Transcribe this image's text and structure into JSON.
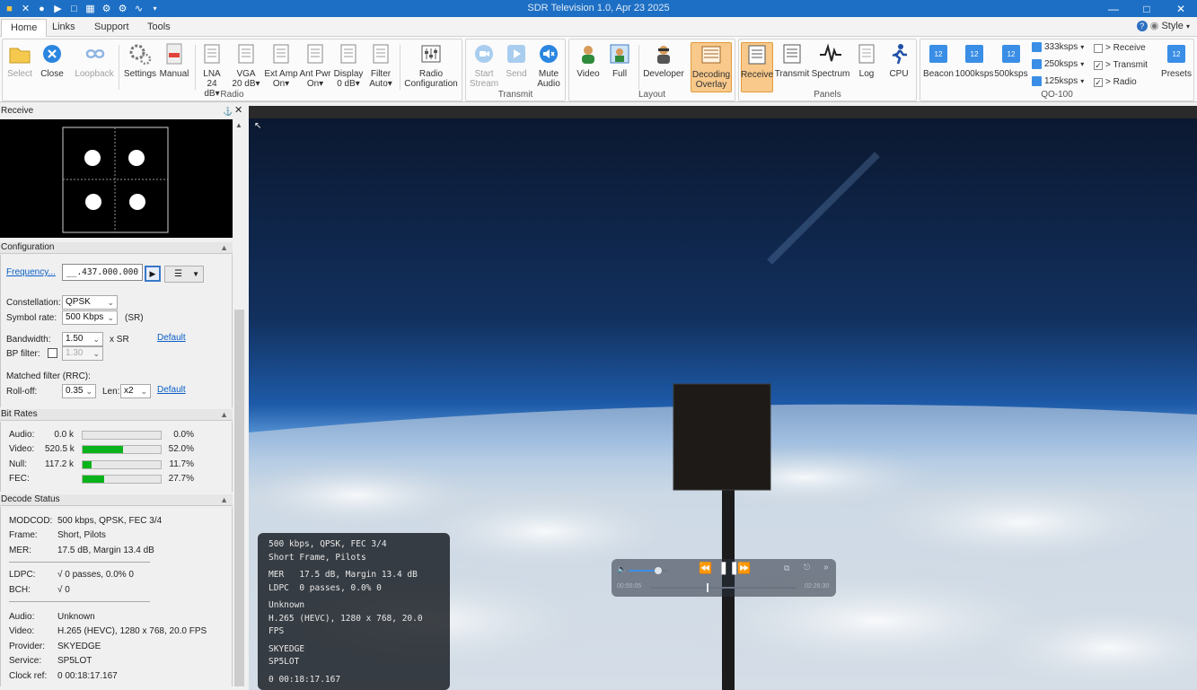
{
  "window": {
    "title": "SDR Television 1.0, Apr 23 2025",
    "controls": [
      "minimize",
      "maximize",
      "close"
    ]
  },
  "tabs": [
    {
      "label": "Home",
      "active": true
    },
    {
      "label": "Links"
    },
    {
      "label": "Support"
    },
    {
      "label": "Tools"
    }
  ],
  "style_label": "Style",
  "ribbon": {
    "radio": {
      "group_label": "Radio",
      "select": "Select",
      "close": "Close",
      "loopback": "Loopback",
      "settings": "Settings",
      "manual": "Manual",
      "lna_1": "LNA",
      "lna_2": "24 dB",
      "vga_1": "VGA",
      "vga_2": "20 dB",
      "extamp_1": "Ext Amp",
      "extamp_2": "On",
      "antpwr_1": "Ant Pwr",
      "antpwr_2": "On",
      "display_1": "Display",
      "display_2": "0 dB",
      "filter_1": "Filter",
      "filter_2": "Auto",
      "radiocfg_1": "Radio",
      "radiocfg_2": "Configuration"
    },
    "transmit": {
      "group_label": "Transmit",
      "start_1": "Start",
      "start_2": "Stream",
      "send": "Send",
      "mute_1": "Mute",
      "mute_2": "Audio"
    },
    "layout": {
      "group_label": "Layout",
      "video": "Video",
      "full": "Full",
      "developer": "Developer",
      "overlay_1": "Decoding",
      "overlay_2": "Overlay"
    },
    "panels": {
      "group_label": "Panels",
      "receive": "Receive",
      "transmit": "Transmit",
      "spectrum": "Spectrum",
      "log": "Log",
      "cpu": "CPU"
    },
    "qo100": {
      "group_label": "QO-100",
      "beacon": "Beacon",
      "k1000": "1000ksps",
      "k500": "500ksps",
      "k333": "333ksps",
      "k250": "250ksps",
      "k125": "125ksps",
      "to_receive": "> Receive",
      "to_transmit": "> Transmit",
      "to_radio": "> Radio",
      "to_receive_checked": false,
      "to_transmit_checked": true,
      "to_radio_checked": true,
      "presets": "Presets"
    }
  },
  "receive_panel": {
    "title": "Receive"
  },
  "configuration": {
    "title": "Configuration",
    "frequency_label": "Frequency...",
    "frequency_value": "__.437.000.000",
    "constellation_label": "Constellation:",
    "constellation_value": "QPSK",
    "symbol_rate_label": "Symbol rate:",
    "symbol_rate_value": "500 Kbps",
    "symbol_rate_suffix": "(SR)",
    "bandwidth_label": "Bandwidth:",
    "bandwidth_value": "1.50",
    "bandwidth_suffix": "x SR",
    "default_1": "Default",
    "bp_filter_label": "BP filter:",
    "bp_filter_value": "1.30",
    "matched_label": "Matched filter (RRC):",
    "rolloff_label": "Roll-off:",
    "rolloff_value": "0.35",
    "len_label": "Len:",
    "len_value": "x2",
    "default_2": "Default"
  },
  "bitrates": {
    "title": "Bit Rates",
    "rows": [
      {
        "label": "Audio:",
        "value": "0.0 k",
        "pct": "0.0%",
        "fraction": 0.0
      },
      {
        "label": "Video:",
        "value": "520.5 k",
        "pct": "52.0%",
        "fraction": 0.52
      },
      {
        "label": "Null:",
        "value": "117.2 k",
        "pct": "11.7%",
        "fraction": 0.117
      },
      {
        "label": "FEC:",
        "value": "",
        "pct": "27.7%",
        "fraction": 0.277
      }
    ]
  },
  "decode": {
    "title": "Decode Status",
    "modcod_label": "MODCOD:",
    "modcod": "500 kbps, QPSK, FEC 3/4",
    "frame_label": "Frame:",
    "frame": "Short, Pilots",
    "mer_label": "MER:",
    "mer": "17.5 dB, Margin 13.4 dB",
    "ldpc_label": "LDPC:",
    "ldpc": "√ 0 passes, 0.0% 0",
    "bch_label": "BCH:",
    "bch": "√ 0",
    "audio_label": "Audio:",
    "audio": "Unknown",
    "video_label": "Video:",
    "video": "H.265 (HEVC), 1280 x 768, 20.0 FPS",
    "provider_label": "Provider:",
    "provider": "SKYEDGE",
    "service_label": "Service:",
    "service": "SP5LOT",
    "clock_label": "Clock ref:",
    "clock": "0 00:18:17.167"
  },
  "osd": {
    "line1": "500 kbps, QPSK, FEC 3/4",
    "line2": "Short Frame, Pilots",
    "line3": "MER   17.5 dB, Margin 13.4 dB",
    "line4": "LDPC  0 passes, 0.0% 0",
    "line5": "Unknown",
    "line6": "H.265 (HEVC), 1280 x 768, 20.0 FPS",
    "line7": "SKYEDGE",
    "line8": "SP5LOT",
    "line9": "0 00:18:17.167"
  },
  "player": {
    "elapsed": "00:55:05",
    "total": "02:26:30",
    "volume_fraction": 0.75,
    "progress_fraction": 0.38
  },
  "colors": {
    "titlebar": "#1c6fc4",
    "active_button": "#f8c98b",
    "bar_fill": "#0ab31b",
    "link": "#0a5fc7"
  }
}
